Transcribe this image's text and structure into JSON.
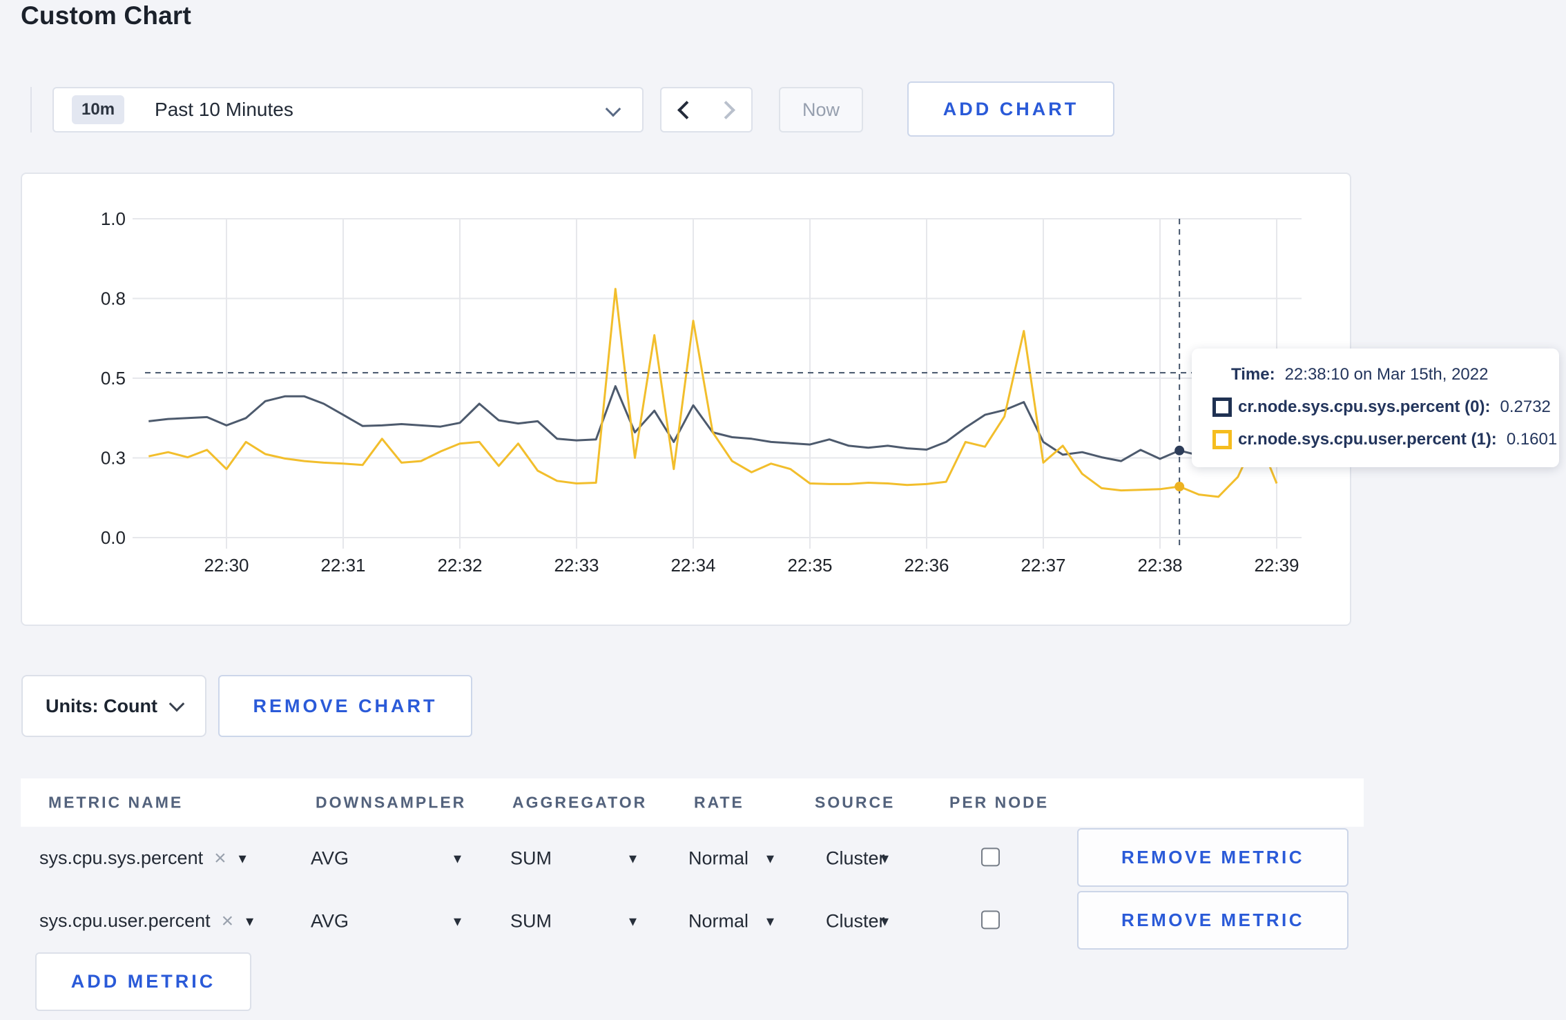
{
  "page": {
    "title": "Custom Chart",
    "accent_blue": "#2a5ad8",
    "background": "#f3f4f8"
  },
  "toolbar": {
    "time_range": {
      "badge": "10m",
      "label": "Past 10 Minutes"
    },
    "now_label": "Now",
    "add_chart_label": "ADD CHART"
  },
  "icons": {
    "close": "×",
    "caret_down": "▾"
  },
  "chart_data": {
    "type": "line",
    "title": "",
    "xlabel": "",
    "ylabel": "",
    "ylim": [
      0,
      1
    ],
    "grid": true,
    "x_ticks": [
      "22:30",
      "22:31",
      "22:32",
      "22:33",
      "22:34",
      "22:35",
      "22:36",
      "22:37",
      "22:38",
      "22:39"
    ],
    "y_ticks": [
      {
        "v": 0.0,
        "label": "0.0"
      },
      {
        "v": 0.25,
        "label": "0.3"
      },
      {
        "v": 0.5,
        "label": "0.5"
      },
      {
        "v": 0.75,
        "label": "0.8"
      },
      {
        "v": 1.0,
        "label": "1.0"
      }
    ],
    "x_start_time": "22:29:20",
    "x_step_seconds": 10,
    "grid_color": "#e6e7eb",
    "series": [
      {
        "name": "cr.node.sys.cpu.sys.percent (0)",
        "color": "#4d5a6d",
        "marker_color": "#2c3c58",
        "values": [
          0.365,
          0.372,
          0.375,
          0.378,
          0.352,
          0.375,
          0.428,
          0.443,
          0.443,
          0.42,
          0.385,
          0.35,
          0.352,
          0.356,
          0.352,
          0.348,
          0.36,
          0.42,
          0.368,
          0.358,
          0.365,
          0.31,
          0.305,
          0.308,
          0.475,
          0.33,
          0.398,
          0.3,
          0.415,
          0.33,
          0.315,
          0.31,
          0.3,
          0.296,
          0.292,
          0.308,
          0.288,
          0.282,
          0.288,
          0.28,
          0.276,
          0.3,
          0.345,
          0.385,
          0.4,
          0.425,
          0.3,
          0.26,
          0.268,
          0.252,
          0.24,
          0.275,
          0.247,
          0.2732,
          0.258,
          0.255,
          0.26,
          0.256,
          0.26
        ]
      },
      {
        "name": "cr.node.sys.cpu.user.percent (1)",
        "color": "#f2be2c",
        "marker_color": "#edb222",
        "values": [
          0.255,
          0.268,
          0.252,
          0.275,
          0.215,
          0.3,
          0.262,
          0.248,
          0.24,
          0.235,
          0.232,
          0.228,
          0.31,
          0.235,
          0.24,
          0.27,
          0.295,
          0.3,
          0.225,
          0.295,
          0.21,
          0.178,
          0.17,
          0.172,
          0.78,
          0.25,
          0.635,
          0.215,
          0.68,
          0.33,
          0.24,
          0.205,
          0.232,
          0.215,
          0.17,
          0.168,
          0.168,
          0.172,
          0.17,
          0.165,
          0.168,
          0.175,
          0.3,
          0.285,
          0.38,
          0.648,
          0.235,
          0.288,
          0.2,
          0.155,
          0.148,
          0.15,
          0.152,
          0.1601,
          0.135,
          0.128,
          0.19,
          0.32,
          0.17
        ]
      }
    ],
    "crosshair": {
      "time": "22:38:10",
      "y_value": 0.517,
      "color": "#44546a"
    },
    "legend_position": "tooltip"
  },
  "chart": {
    "tooltip": {
      "time_label": "Time:",
      "time_value": "22:38:10 on Mar 15th, 2022",
      "entries": [
        {
          "label": "cr.node.sys.cpu.sys.percent (0):",
          "value": "0.2732",
          "square_color": "#1f3152"
        },
        {
          "label": "cr.node.sys.cpu.user.percent (1):",
          "value": "0.1601",
          "square_color": "#f5bd1f"
        }
      ]
    }
  },
  "units_button": {
    "label": "Units: Count"
  },
  "remove_chart_label": "REMOVE CHART",
  "metrics_table": {
    "columns": [
      "METRIC NAME",
      "DOWNSAMPLER",
      "AGGREGATOR",
      "RATE",
      "SOURCE",
      "PER NODE"
    ],
    "rows": [
      {
        "name": "sys.cpu.sys.percent",
        "downsampler": "AVG",
        "aggregator": "SUM",
        "rate": "Normal",
        "source": "Cluster",
        "per_node": false,
        "remove_label": "REMOVE METRIC"
      },
      {
        "name": "sys.cpu.user.percent",
        "downsampler": "AVG",
        "aggregator": "SUM",
        "rate": "Normal",
        "source": "Cluster",
        "per_node": false,
        "remove_label": "REMOVE METRIC"
      }
    ],
    "add_metric_label": "ADD METRIC"
  }
}
